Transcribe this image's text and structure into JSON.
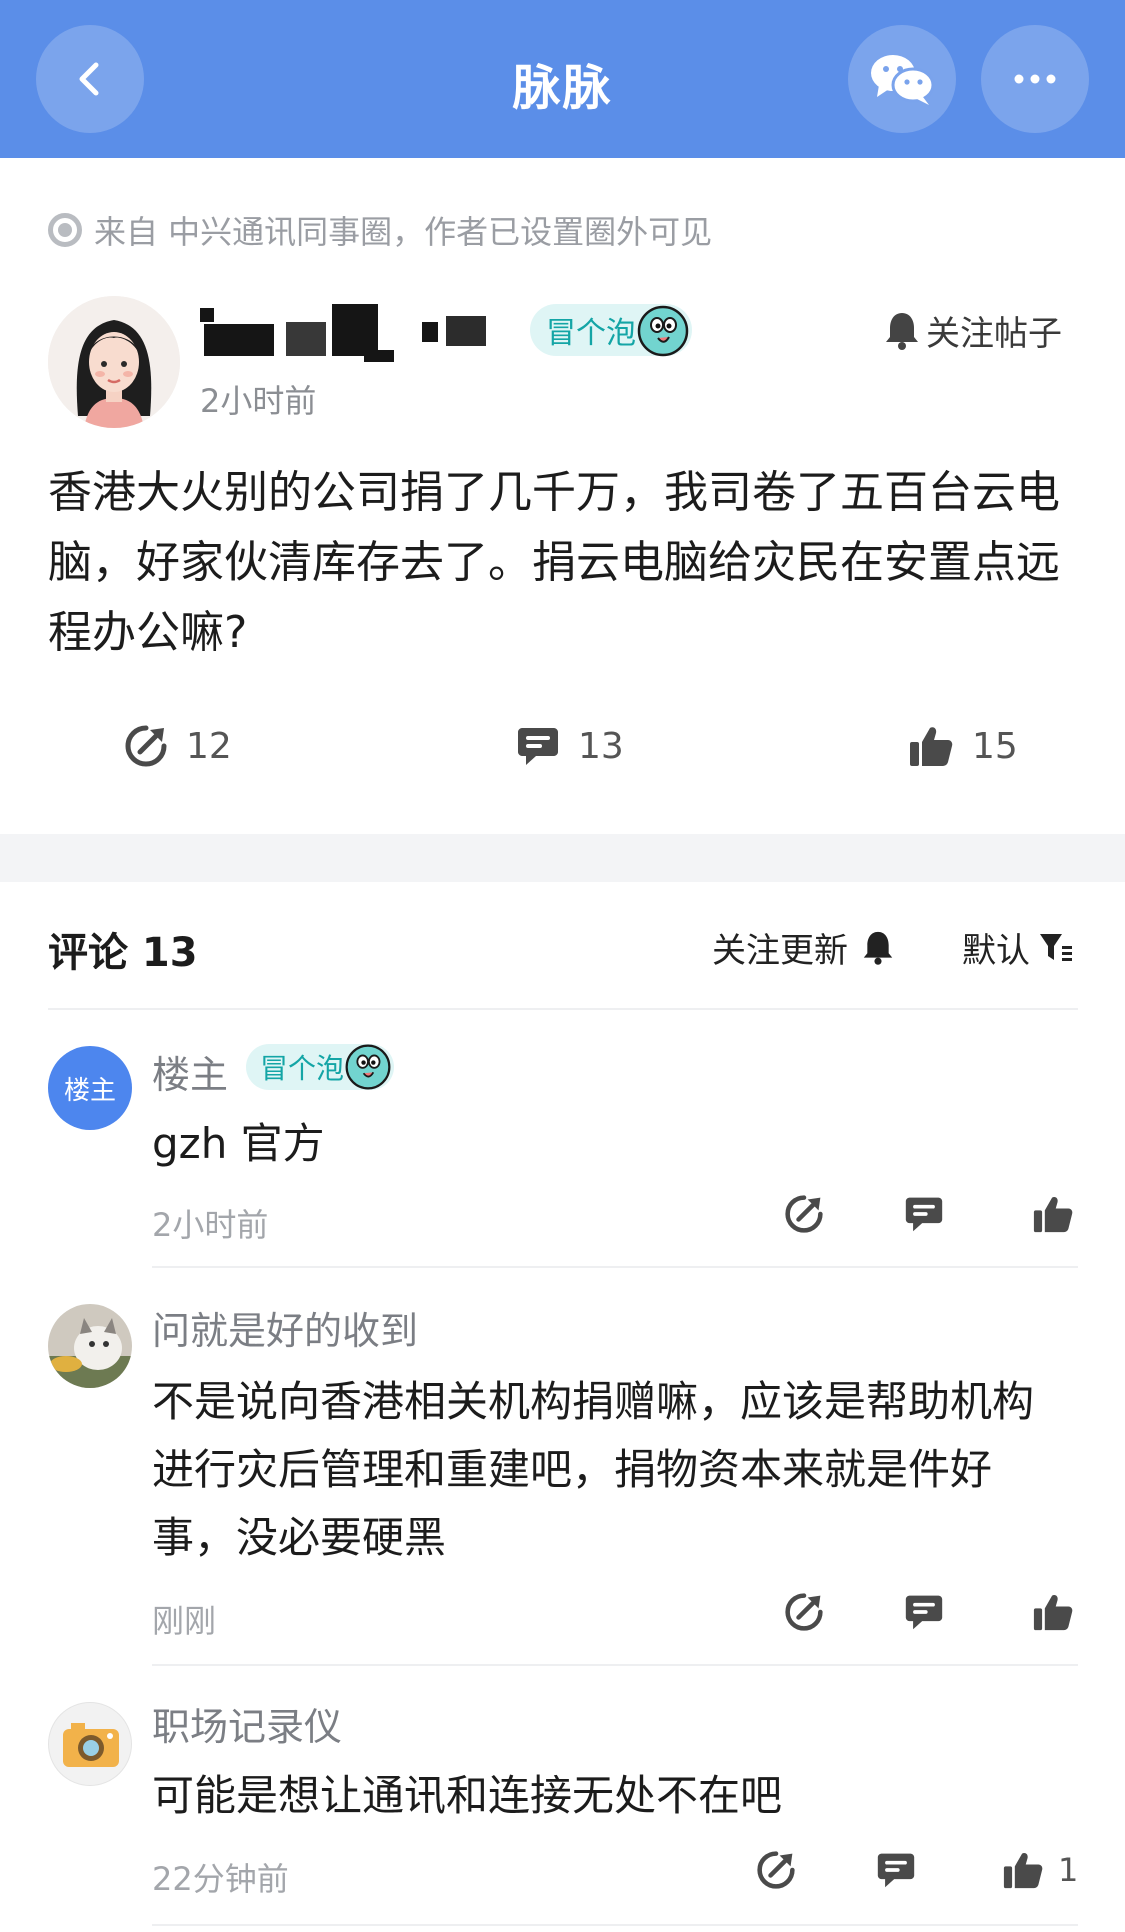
{
  "header": {
    "title": "脉脉",
    "back_icon": "chevron-left-icon",
    "share_icon": "wechat-icon",
    "more_icon": "more-dots-icon"
  },
  "source": {
    "text": "来自 中兴通讯同事圈，作者已设置圈外可见"
  },
  "post": {
    "badge": "冒个泡",
    "follow_label": "关注帖子",
    "time": "2小时前",
    "body": "香港大火别的公司捐了几千万，我司卷了五百台云电脑，好家伙清库存去了。捐云电脑给灾民在安置点远程办公嘛?",
    "share_count": "12",
    "comment_count": "13",
    "like_count": "15"
  },
  "comments_header": {
    "title": "评论 13",
    "follow_label": "关注更新",
    "sort_label": "默认"
  },
  "comments": [
    {
      "avatar_text": "楼主",
      "name": "楼主",
      "badge": "冒个泡",
      "text": "gzh 官方",
      "time": "2小时前",
      "like_count": ""
    },
    {
      "avatar_text": "",
      "name": "问就是好的收到",
      "badge": "",
      "text": "不是说向香港相关机构捐赠嘛，应该是帮助机构进行灾后管理和重建吧，捐物资本来就是件好事，没必要硬黑",
      "time": "刚刚",
      "like_count": ""
    },
    {
      "avatar_text": "",
      "name": "职场记录仪",
      "badge": "",
      "text": "可能是想让通讯和连接无处不在吧",
      "time": "22分钟前",
      "like_count": "1"
    }
  ],
  "colors": {
    "header_bg": "#5b8ee8",
    "badge_bg": "#dff5f5",
    "badge_text": "#14a5a6",
    "host_avatar": "#4d86ee"
  }
}
